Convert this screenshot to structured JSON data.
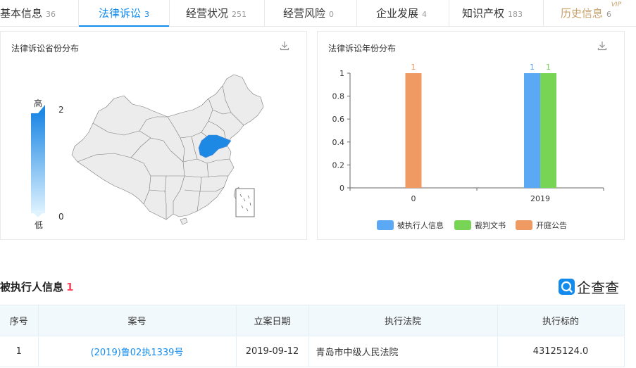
{
  "tabs": [
    {
      "label": "基本信息",
      "count": "36"
    },
    {
      "label": "法律诉讼",
      "count": "3"
    },
    {
      "label": "经营状况",
      "count": "251"
    },
    {
      "label": "经营风险",
      "count": "0"
    },
    {
      "label": "企业发展",
      "count": "4"
    },
    {
      "label": "知识产权",
      "count": "183"
    },
    {
      "label": "历史信息",
      "count": "6"
    }
  ],
  "vip_badge": "VIP",
  "map_panel": {
    "title": "法律诉讼省份分布",
    "scale_high_label": "高",
    "scale_low_label": "低",
    "scale_max": "2",
    "scale_min": "0",
    "highlight_color": "#1e88e5",
    "base_color": "#ececec"
  },
  "year_panel": {
    "title": "法律诉讼年份分布"
  },
  "chart_data": {
    "type": "bar",
    "title": "法律诉讼年份分布",
    "categories": [
      "0",
      "2019"
    ],
    "series": [
      {
        "name": "被执行人信息",
        "color": "#5ba8f5",
        "values": [
          0,
          1
        ]
      },
      {
        "name": "裁判文书",
        "color": "#77d455",
        "values": [
          0,
          1
        ]
      },
      {
        "name": "开庭公告",
        "color": "#ef9a62",
        "values": [
          1,
          0
        ]
      }
    ],
    "yticks": [
      "0",
      "0.2",
      "0.4",
      "0.6",
      "0.8",
      "1"
    ],
    "ylim": [
      0,
      1
    ],
    "legend_position": "bottom"
  },
  "section": {
    "title": "被执行人信息",
    "count": "1",
    "logo_text": "企查查"
  },
  "table": {
    "headers": [
      "序号",
      "案号",
      "立案日期",
      "执行法院",
      "执行标的"
    ],
    "rows": [
      [
        "1",
        "(2019)鲁02执1339号",
        "2019-09-12",
        "青岛市中级人民法院",
        "43125124.0"
      ]
    ]
  }
}
